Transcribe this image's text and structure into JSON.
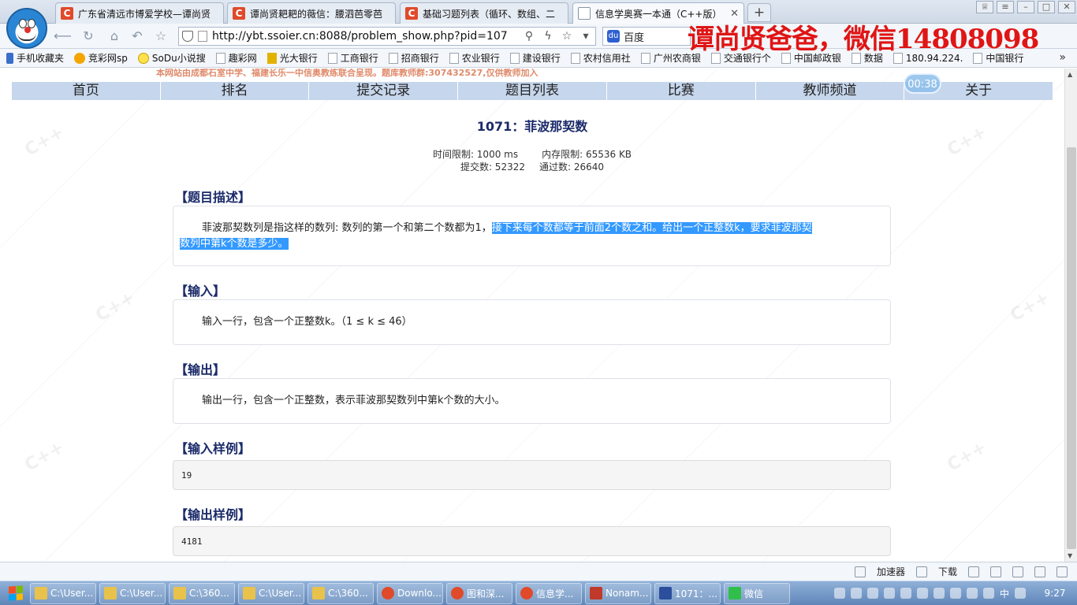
{
  "browser": {
    "tabs": [
      {
        "title": "广东省清远市博爱学校—谭尚贤",
        "icon": "c-app-icon"
      },
      {
        "title": "谭尚贤耙耙的薇信：腰泗芭零芭",
        "icon": "c-app-icon"
      },
      {
        "title": "基础习题列表（循环、数组、二",
        "icon": "c-app-icon"
      },
      {
        "title": "信息学奥赛一本通（C++版）",
        "icon": "page-icon"
      }
    ],
    "url": "http://ybt.ssoier.cn:8088/problem_show.php?pid=107",
    "search_engine": "百度",
    "watermark": "谭尚贤爸爸，微信14808098",
    "bookmarks": [
      "手机收藏夹",
      "竞彩网sp",
      "SoDu小说搜",
      "趣彩网",
      "光大银行",
      "工商银行",
      "招商银行",
      "农业银行",
      "建设银行",
      "农村信用社",
      "广州农商银",
      "交通银行个",
      "中国邮政银",
      "数据",
      "180.94.224.",
      "中国银行"
    ],
    "more": "»"
  },
  "site": {
    "notice": "本网站由成都石室中学、福建长乐一中信奥教练联合呈现。题库教师群:307432527,仅供教师加入",
    "menu": [
      "首页",
      "排名",
      "提交记录",
      "题目列表",
      "比赛",
      "教师频道",
      "关于"
    ],
    "timer": "00:38",
    "watermark_tile": "C++"
  },
  "problem": {
    "title": "1071：菲波那契数",
    "time_limit": "时间限制: 1000 ms",
    "memory_limit": "内存限制: 65536 KB",
    "submissions": "提交数: 52322",
    "accepted": "通过数: 26640",
    "desc_heading": "【题目描述】",
    "desc_plain": "菲波那契数列是指这样的数列: 数列的第一个和第二个数都为1，",
    "desc_selected_1": "接下来每个数都等于前面2个数之和。给出一个正整数k，要求菲波那契",
    "desc_selected_2": "数列中第k个数是多少。",
    "input_heading": "【输入】",
    "input_text": "输入一行，包含一个正整数k。（1 ≤ k ≤ 46）",
    "output_heading": "【输出】",
    "output_text": "输出一行，包含一个正整数，表示菲波那契数列中第k个数的大小。",
    "sample_in_heading": "【输入样例】",
    "sample_in": "19",
    "sample_out_heading": "【输出样例】",
    "sample_out": "4181"
  },
  "statusbar": {
    "accelerator": "加速器",
    "download": "下载"
  },
  "taskbar": {
    "items": [
      {
        "label": "C:\\User...",
        "color": "#e8c24a"
      },
      {
        "label": "C:\\User...",
        "color": "#e8c24a"
      },
      {
        "label": "C:\\360...",
        "color": "#e8c24a"
      },
      {
        "label": "C:\\User...",
        "color": "#e8c24a"
      },
      {
        "label": "C:\\360...",
        "color": "#e8c24a"
      },
      {
        "label": "Downlo...",
        "color": "#e04a2a"
      },
      {
        "label": "图和深...",
        "color": "#e04a2a"
      },
      {
        "label": "信息学...",
        "color": "#e04a2a"
      },
      {
        "label": "Nonam...",
        "color": "#c0392b"
      },
      {
        "label": "1071：...",
        "color": "#2b4f9c"
      },
      {
        "label": "微信",
        "color": "#2fbf4a"
      }
    ],
    "ime": "中",
    "clock": "9:27"
  }
}
